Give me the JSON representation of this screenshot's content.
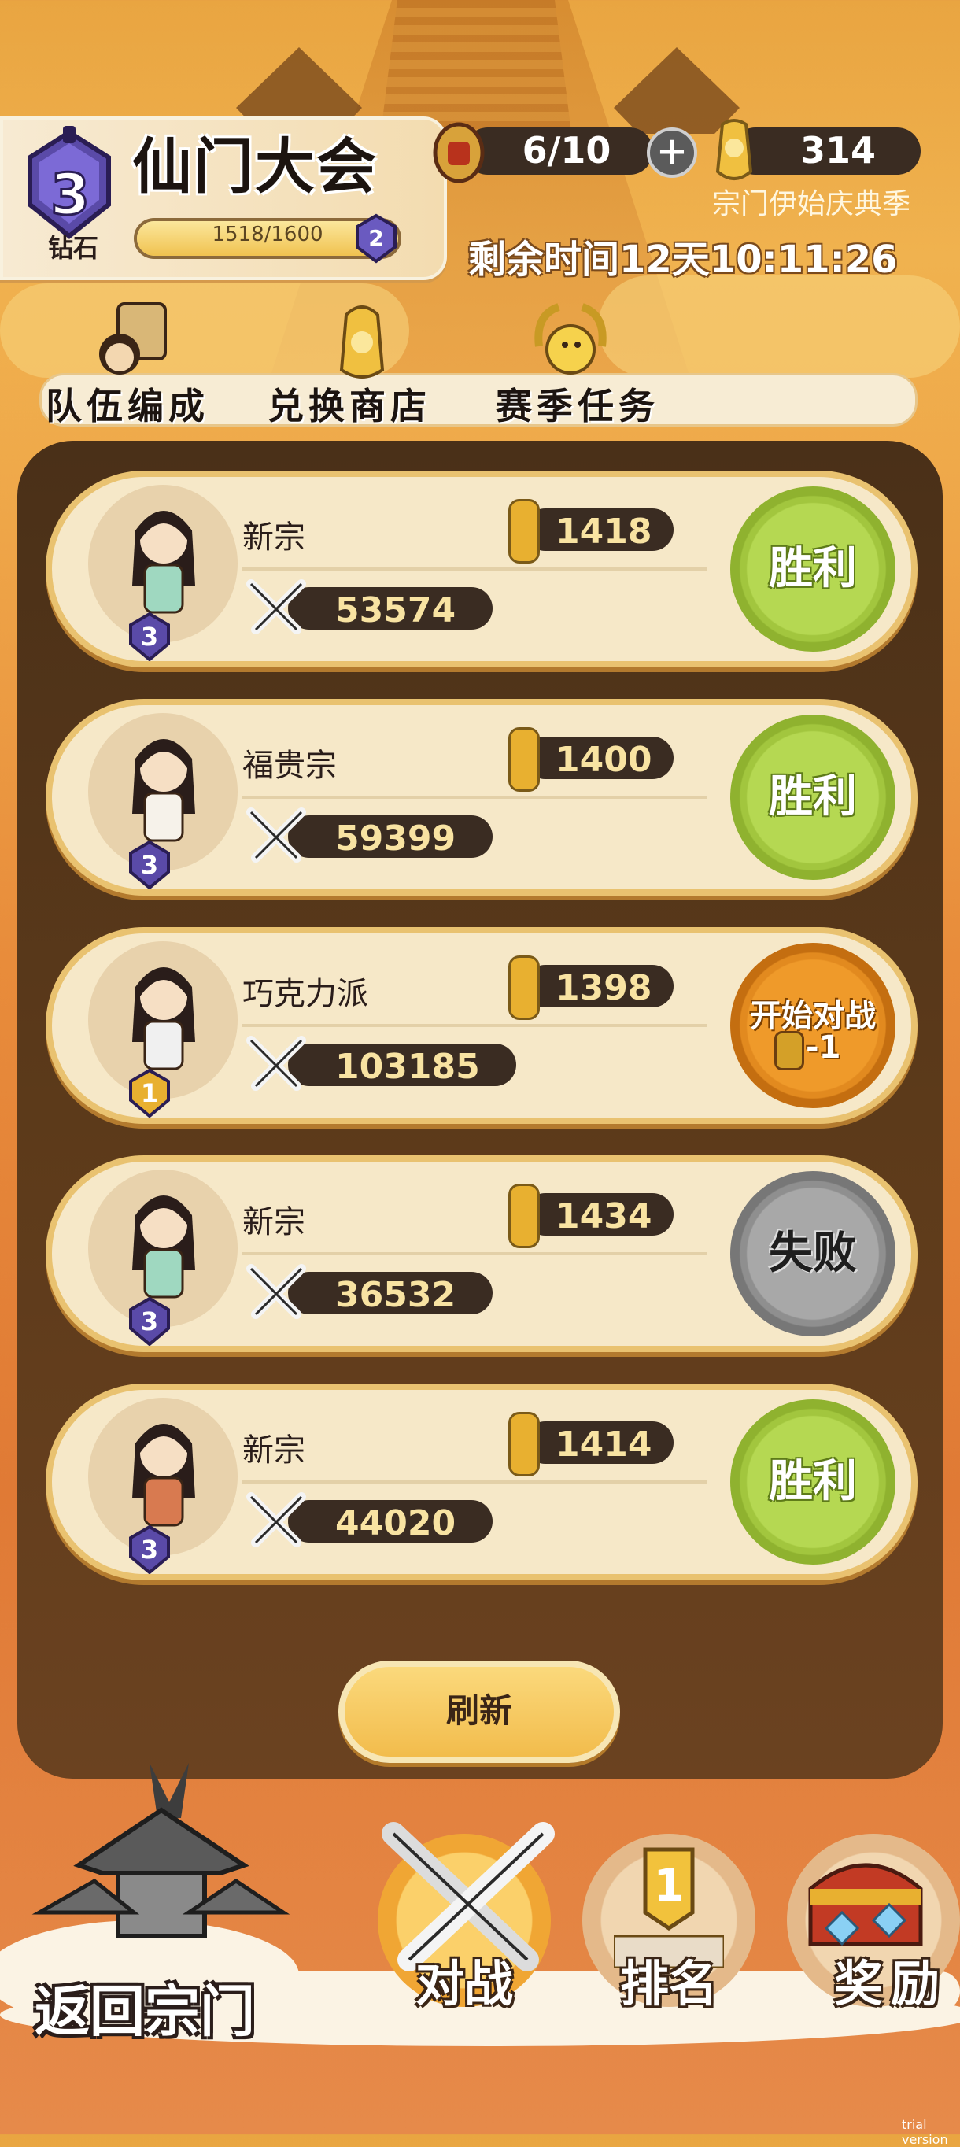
{
  "header": {
    "title": "仙门大会",
    "rank_level": "3",
    "rank_name": "钻石",
    "progress_text": "1518/1600",
    "progress_fraction": 0.949,
    "next_rank_level": "2",
    "tickets_text": "6/10",
    "currency_amount": "314",
    "season_name": "宗门伊始庆典季",
    "time_remaining": "剩余时间12天10:11:26"
  },
  "nav": {
    "team": "队伍编成",
    "shop": "兑换商店",
    "tasks": "赛季任务"
  },
  "opponents": [
    {
      "name": "新宗",
      "rank": "3",
      "score": "1418",
      "power": "53574",
      "result": "胜利",
      "state": "win"
    },
    {
      "name": "福贵宗",
      "rank": "3",
      "score": "1400",
      "power": "59399",
      "result": "胜利",
      "state": "win"
    },
    {
      "name": "巧克力派",
      "rank": "1",
      "score": "1398",
      "power": "103185",
      "result": "开始对战",
      "cost": "-1",
      "state": "fight"
    },
    {
      "name": "新宗",
      "rank": "3",
      "score": "1434",
      "power": "36532",
      "result": "失败",
      "state": "lose"
    },
    {
      "name": "新宗",
      "rank": "3",
      "score": "1414",
      "power": "44020",
      "result": "胜利",
      "state": "win"
    }
  ],
  "refresh_label": "刷新",
  "bottom": {
    "back": "返回宗门",
    "battle": "对战",
    "ranking": "排名",
    "rewards": "奖励"
  },
  "watermark": "trial version",
  "colors": {
    "win": "#a2c63e",
    "lose": "#8f8f8f",
    "fight": "#e28a1f",
    "panel": "#4a3018",
    "card": "#f6e8c8"
  }
}
